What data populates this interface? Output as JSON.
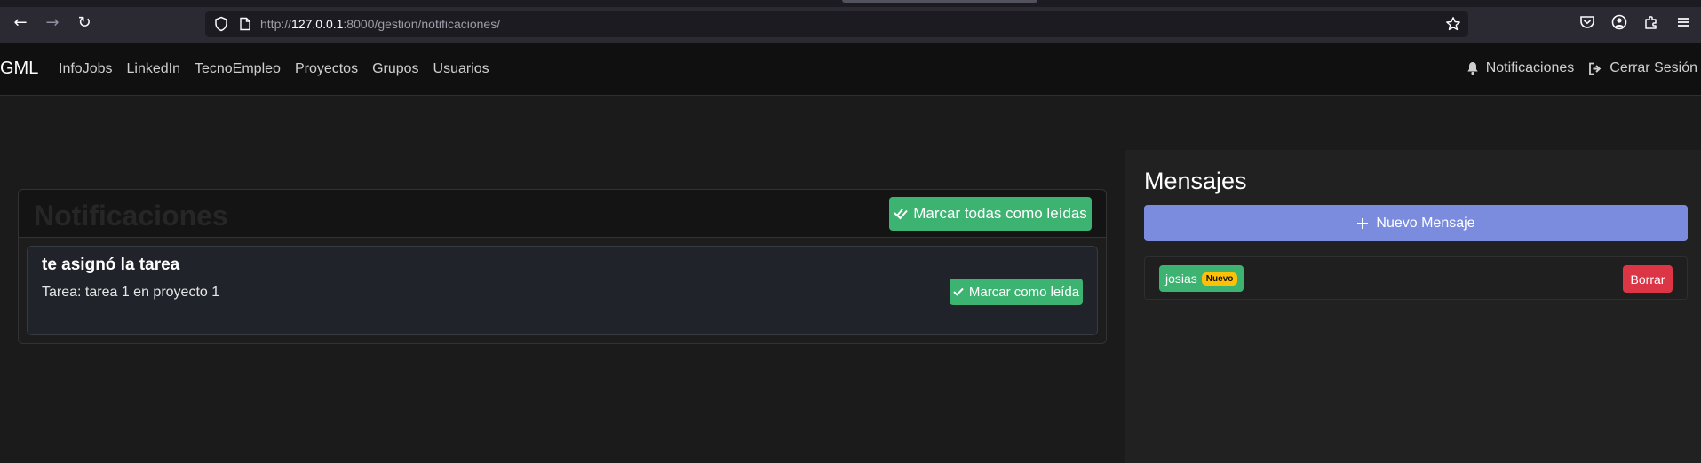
{
  "browser": {
    "url_prefix": "http://",
    "url_host": "127.0.0.1",
    "url_rest": ":8000/gestion/notificaciones/"
  },
  "navbar": {
    "brand": "GML",
    "links": [
      "InfoJobs",
      "LinkedIn",
      "TecnoEmpleo",
      "Proyectos",
      "Grupos",
      "Usuarios"
    ],
    "notifications_label": "Notificaciones",
    "logout_label": "Cerrar Sesión"
  },
  "notifications": {
    "title": "Notificaciones",
    "mark_all_label": "Marcar todas como leídas",
    "items": [
      {
        "title": "te asignó la tarea",
        "text": "Tarea: tarea 1 en proyecto 1",
        "mark_label": "Marcar como leída"
      }
    ]
  },
  "messages": {
    "title": "Mensajes",
    "new_message_label": "Nuevo Mensaje",
    "items": [
      {
        "sender": "josias",
        "badge": "Nuevo",
        "delete_label": "Borrar"
      }
    ]
  },
  "colors": {
    "success": "#3cb371",
    "primary_soft": "#7b8cde",
    "danger": "#dc3545",
    "warning": "#ffc107"
  },
  "icons": {
    "back": "arrow-left-icon",
    "forward": "arrow-right-icon",
    "reload": "reload-icon",
    "bell": "bell-icon",
    "logout": "logout-icon",
    "check_double": "check-double-icon",
    "check": "check-icon",
    "plus": "plus-icon"
  }
}
